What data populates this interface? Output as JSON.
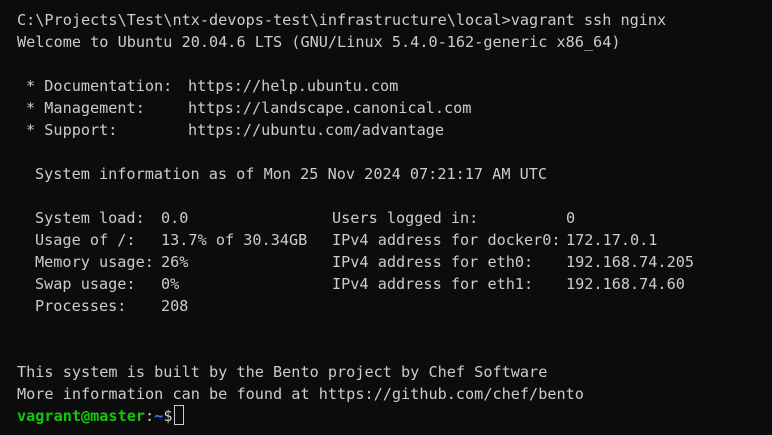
{
  "command_line": "C:\\Projects\\Test\\ntx-devops-test\\infrastructure\\local>vagrant ssh nginx",
  "welcome": "Welcome to Ubuntu 20.04.6 LTS (GNU/Linux 5.4.0-162-generic x86_64)",
  "support_links": [
    {
      "label": "* Documentation:",
      "url": "https://help.ubuntu.com"
    },
    {
      "label": "* Management:",
      "url": "https://landscape.canonical.com"
    },
    {
      "label": "* Support:",
      "url": "https://ubuntu.com/advantage"
    }
  ],
  "sysinfo_header": "System information as of Mon 25 Nov 2024 07:21:17 AM UTC",
  "sysinfo_rows": [
    {
      "label": "System load:",
      "value": "0.0",
      "label2": "Users logged in:",
      "value2": "0"
    },
    {
      "label": "Usage of /:",
      "value": "13.7% of 30.34GB",
      "label2": "IPv4 address for docker0:",
      "value2": "172.17.0.1"
    },
    {
      "label": "Memory usage:",
      "value": "26%",
      "label2": "IPv4 address for eth0:",
      "value2": "192.168.74.205"
    },
    {
      "label": "Swap usage:",
      "value": "0%",
      "label2": "IPv4 address for eth1:",
      "value2": "192.168.74.60"
    },
    {
      "label": "Processes:",
      "value": "208",
      "label2": "",
      "value2": ""
    }
  ],
  "footer_lines": [
    "This system is built by the Bento project by Chef Software",
    "More information can be found at https://github.com/chef/bento"
  ],
  "prompt": {
    "user_host": "vagrant@master",
    "separator": ":",
    "path": "~",
    "symbol": "$"
  },
  "colors": {
    "background": "#0c0c0c",
    "foreground": "#cccccc",
    "prompt_user": "#16c60c",
    "prompt_path": "#3b78ff"
  }
}
